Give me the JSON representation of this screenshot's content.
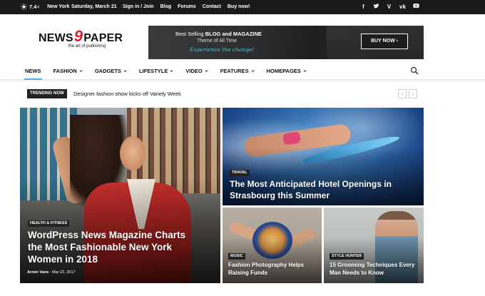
{
  "topbar": {
    "temperature": "7.4",
    "temp_unit": "c",
    "city": "New York",
    "date": "Saturday, March 21",
    "links": [
      "Sign in / Join",
      "Blog",
      "Forums",
      "Contact",
      "Buy now!"
    ],
    "socials": [
      "facebook-icon",
      "twitter-icon",
      "vimeo-icon",
      "vk-icon",
      "youtube-icon"
    ]
  },
  "logo": {
    "word1": "NEWS",
    "digit": "9",
    "word2": "PAPER",
    "tagline": "the art of publishing"
  },
  "banner": {
    "line1_prefix": "Best Selling ",
    "line1_bold": "BLOG and MAGAZINE",
    "line2": "Theme of All Time",
    "line3": "Experience the change!",
    "button": "BUY NOW ›"
  },
  "nav": {
    "items": [
      {
        "label": "NEWS",
        "active": true,
        "dropdown": false
      },
      {
        "label": "FASHION",
        "active": false,
        "dropdown": true
      },
      {
        "label": "GADGETS",
        "active": false,
        "dropdown": true
      },
      {
        "label": "LIFESTYLE",
        "active": false,
        "dropdown": true
      },
      {
        "label": "VIDEO",
        "active": false,
        "dropdown": true
      },
      {
        "label": "FEATURES",
        "active": false,
        "dropdown": true
      },
      {
        "label": "HOMEPAGES",
        "active": false,
        "dropdown": true
      }
    ]
  },
  "trending": {
    "badge": "TRENDING NOW",
    "headline": "Designer fashion show kicks off Variety Week",
    "prev": "‹",
    "next": "›"
  },
  "grid": {
    "big": {
      "category": "HEALTH & FITNESS",
      "title": "WordPress News Magazine Charts the Most Fashionable New York Women in 2018",
      "author": "Armin Vans",
      "separator": " - ",
      "date": "Mar 22, 2017"
    },
    "top_right": {
      "category": "TRAVEL",
      "title": "The Most Anticipated Hotel Openings in Strasbourg this Summer"
    },
    "bottom_mid": {
      "category": "MUSIC",
      "title": "Fashion Photography Helps Raising Funds"
    },
    "bottom_right": {
      "category": "STYLE HUNTER",
      "title": "15 Grooming Techniques Every Man Needs to Know"
    }
  },
  "colors": {
    "accent": "#4db2ec",
    "logo_red": "#e31837",
    "topbar_bg": "#1a1a1a"
  }
}
